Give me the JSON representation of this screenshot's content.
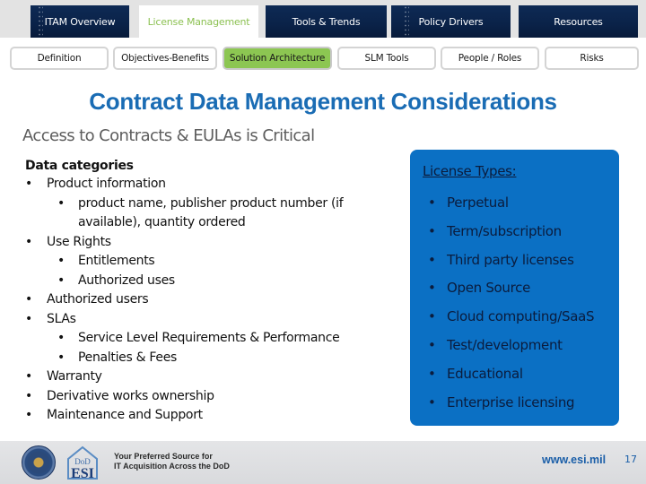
{
  "top_tabs": [
    {
      "label": "ITAM Overview",
      "active": false
    },
    {
      "label": "License Management",
      "active": true
    },
    {
      "label": "Tools & Trends",
      "active": false
    },
    {
      "label": "Policy Drivers",
      "active": false
    },
    {
      "label": "Resources",
      "active": false
    }
  ],
  "sub_nav": [
    {
      "label": "Definition",
      "active": false
    },
    {
      "label": "Objectives-Benefits",
      "active": false
    },
    {
      "label": "Solution Architecture",
      "active": true
    },
    {
      "label": "SLM Tools",
      "active": false
    },
    {
      "label": "People / Roles",
      "active": false
    },
    {
      "label": "Risks",
      "active": false
    }
  ],
  "title": "Contract Data Management Considerations",
  "subtitle": "Access to Contracts & EULAs is Critical",
  "data_categories": {
    "heading": "Data categories",
    "bullet": "•",
    "items": [
      {
        "level": 1,
        "text": "Product information"
      },
      {
        "level": 2,
        "text": "product name, publisher product number (if available), quantity ordered"
      },
      {
        "level": 1,
        "text": "Use Rights"
      },
      {
        "level": 2,
        "text": "Entitlements"
      },
      {
        "level": 2,
        "text": "Authorized uses"
      },
      {
        "level": 1,
        "text": "Authorized users"
      },
      {
        "level": 1,
        "text": "SLAs"
      },
      {
        "level": 2,
        "text": "Service Level Requirements & Performance"
      },
      {
        "level": 2,
        "text": "Penalties & Fees"
      },
      {
        "level": 1,
        "text": "Warranty"
      },
      {
        "level": 1,
        "text": "Derivative works ownership"
      },
      {
        "level": 1,
        "text": "Maintenance and Support"
      }
    ]
  },
  "license_types": {
    "heading": "License Types:",
    "bullet": "•",
    "items": [
      "Perpetual",
      "Term/subscription",
      "Third party licenses",
      "Open Source",
      "Cloud computing/SaaS",
      "Test/development",
      "Educational",
      "Enterprise licensing"
    ]
  },
  "footer": {
    "logo_seal": "Department of Defense seal",
    "logo_esi_top": "DoD",
    "logo_esi_bottom": "ESI",
    "tagline_line1": "Your Preferred Source for",
    "tagline_line2": "IT Acquisition Across the DoD",
    "url": "www.esi.mil",
    "page_number": "17"
  },
  "colors": {
    "nav_dark": "#0a2248",
    "active_green": "#8cc652",
    "title_blue": "#1a6cb4",
    "box_blue": "#0b70c4"
  }
}
